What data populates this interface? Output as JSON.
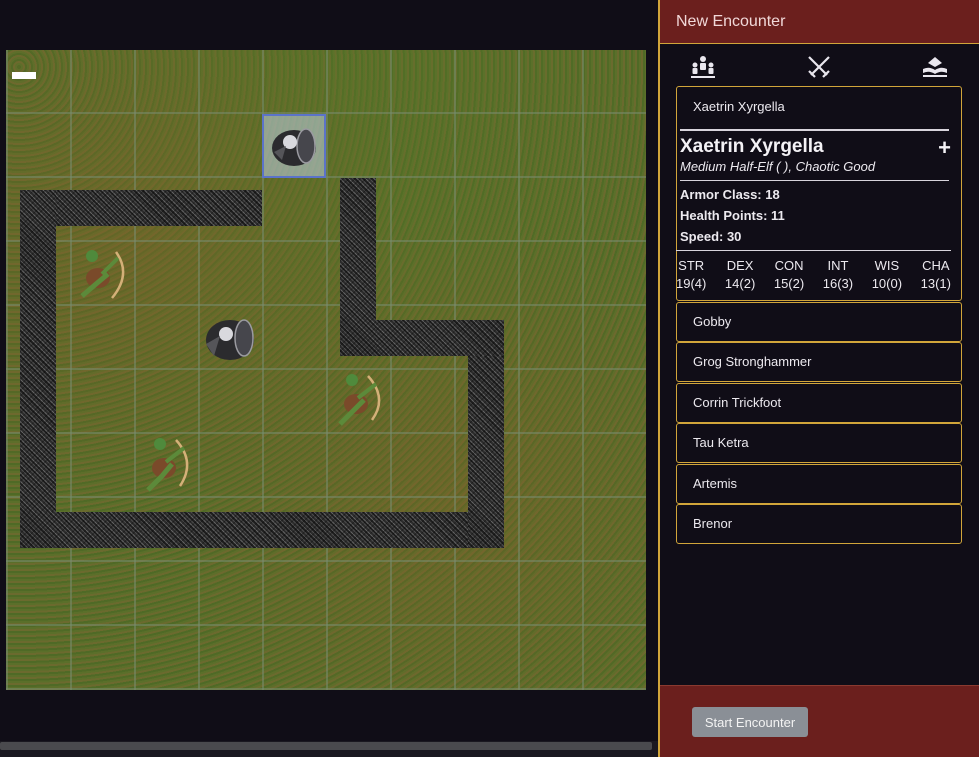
{
  "panel": {
    "title": "New Encounter",
    "tools": [
      {
        "icon": "party-icon"
      },
      {
        "icon": "crossed-swords-icon"
      },
      {
        "icon": "open-book-icon"
      }
    ],
    "selected_creature": {
      "list_name": "Xaetrin Xyrgella",
      "name": "Xaetrin Xyrgella",
      "add_symbol": "+",
      "subtitle": "Medium Half-Elf ( ), Chaotic Good",
      "armor_class": "Armor Class: 18",
      "health_points": "Health Points: 11",
      "speed": "Speed: 30",
      "abilities": [
        {
          "key": "STR",
          "value": "19(4)"
        },
        {
          "key": "DEX",
          "value": "14(2)"
        },
        {
          "key": "CON",
          "value": "15(2)"
        },
        {
          "key": "INT",
          "value": "16(3)"
        },
        {
          "key": "WIS",
          "value": "10(0)"
        },
        {
          "key": "CHA",
          "value": "13(1)"
        }
      ]
    },
    "creatures": [
      "Gobby",
      "Grog Stronghammer",
      "Corrin Trickfoot",
      "Tau Ketra",
      "Artemis",
      "Brenor"
    ],
    "start_label": "Start Encounter"
  },
  "colors": {
    "panel_header": "#6b1f1d",
    "panel_border": "#d1a53a",
    "background": "#100d17",
    "start_button": "#8a8f96"
  },
  "map": {
    "grid": "10x10",
    "tokens": [
      "armored-warrior-token",
      "goblin-archer-token",
      "armored-warrior-token",
      "goblin-archer-token",
      "goblin-archer-token"
    ]
  }
}
